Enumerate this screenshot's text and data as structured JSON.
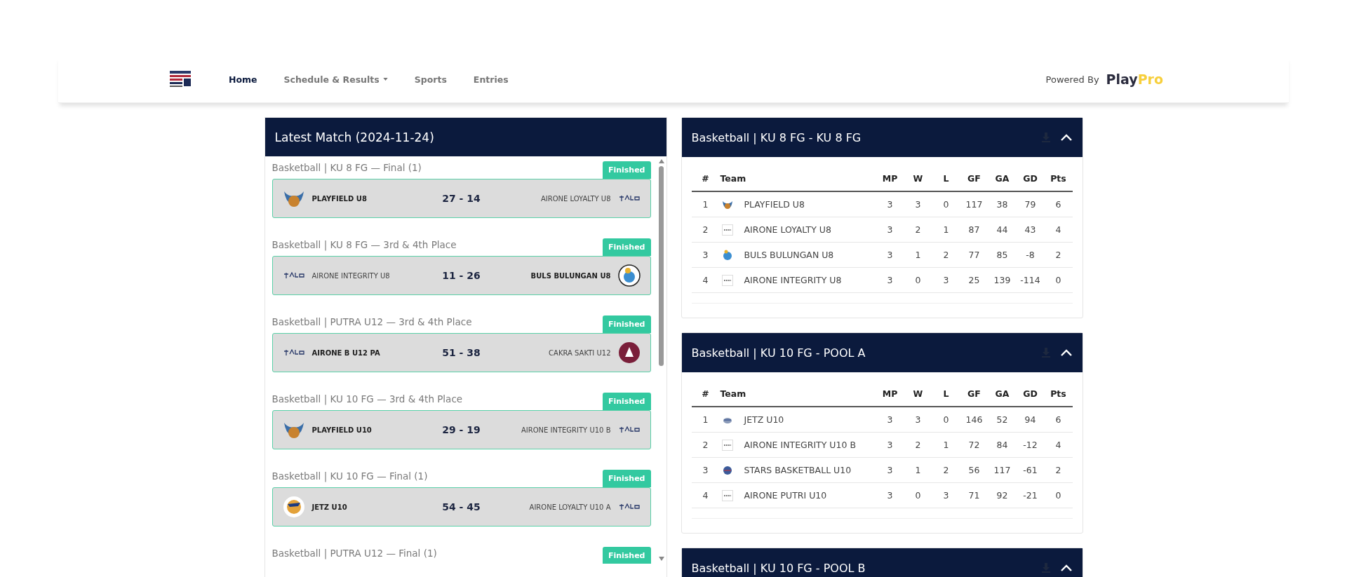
{
  "nav": {
    "items": [
      {
        "label": "Home",
        "selected": true,
        "dropdown": false
      },
      {
        "label": "Schedule & Results",
        "selected": false,
        "dropdown": true
      },
      {
        "label": "Sports",
        "selected": false,
        "dropdown": false
      },
      {
        "label": "Entries",
        "selected": false,
        "dropdown": false
      }
    ],
    "powered_by": "Powered By",
    "brand": {
      "first": "Play",
      "second": "Pro"
    }
  },
  "latest": {
    "title": "Latest Match (2024-11-24)",
    "matches": [
      {
        "round": "Basketball | KU 8 FG — Final (1)",
        "status": "Finished",
        "score": "27 - 14",
        "home": {
          "name": "PLAYFIELD U8",
          "kind": "wings",
          "winner": true
        },
        "away": {
          "name": "AIRONE LOYALTY U8",
          "kind": "airone",
          "winner": false
        }
      },
      {
        "round": "Basketball | KU 8 FG — 3rd & 4th Place",
        "status": "Finished",
        "score": "11 - 26",
        "home": {
          "name": "AIRONE INTEGRITY U8",
          "kind": "airone",
          "winner": false
        },
        "away": {
          "name": "BULS BULUNGAN U8",
          "kind": "bull",
          "winner": true
        }
      },
      {
        "round": "Basketball | PUTRA U12 — 3rd & 4th Place",
        "status": "Finished",
        "score": "51 - 38",
        "home": {
          "name": "AIRONE B U12 PA",
          "kind": "airone",
          "winner": true
        },
        "away": {
          "name": "CAKRA SAKTI U12",
          "kind": "maroon",
          "winner": false
        }
      },
      {
        "round": "Basketball | KU 10 FG — 3rd & 4th Place",
        "status": "Finished",
        "score": "29 - 19",
        "home": {
          "name": "PLAYFIELD U10",
          "kind": "wings",
          "winner": true
        },
        "away": {
          "name": "AIRONE INTEGRITY U10 B",
          "kind": "airone",
          "winner": false
        }
      },
      {
        "round": "Basketball | KU 10 FG — Final (1)",
        "status": "Finished",
        "score": "54 - 45",
        "home": {
          "name": "JETZ U10",
          "kind": "jet",
          "winner": true
        },
        "away": {
          "name": "AIRONE LOYALTY U10 A",
          "kind": "airone",
          "winner": false
        }
      },
      {
        "round": "Basketball | PUTRA U12 — Final (1)",
        "status": "Finished"
      }
    ]
  },
  "standings": [
    {
      "title": "Basketball | KU 8 FG - KU 8 FG",
      "expanded": true,
      "columns": [
        "#",
        "Team",
        "MP",
        "W",
        "L",
        "GF",
        "GA",
        "GD",
        "Pts"
      ],
      "rows": [
        {
          "kind": "wings",
          "cells": [
            "1",
            "PLAYFIELD U8",
            "3",
            "3",
            "0",
            "117",
            "38",
            "79",
            "6"
          ]
        },
        {
          "kind": "airone",
          "cells": [
            "2",
            "AIRONE LOYALTY U8",
            "3",
            "2",
            "1",
            "87",
            "44",
            "43",
            "4"
          ]
        },
        {
          "kind": "bull",
          "cells": [
            "3",
            "BULS BULUNGAN U8",
            "3",
            "1",
            "2",
            "77",
            "85",
            "-8",
            "2"
          ]
        },
        {
          "kind": "airone",
          "cells": [
            "4",
            "AIRONE INTEGRITY U8",
            "3",
            "0",
            "3",
            "25",
            "139",
            "-114",
            "0"
          ]
        }
      ]
    },
    {
      "title": "Basketball | KU 10 FG - POOL A",
      "expanded": true,
      "columns": [
        "#",
        "Team",
        "MP",
        "W",
        "L",
        "GF",
        "GA",
        "GD",
        "Pts"
      ],
      "rows": [
        {
          "kind": "jet",
          "cells": [
            "1",
            "JETZ U10",
            "3",
            "3",
            "0",
            "146",
            "52",
            "94",
            "6"
          ]
        },
        {
          "kind": "airone",
          "cells": [
            "2",
            "AIRONE INTEGRITY U10 B",
            "3",
            "2",
            "1",
            "72",
            "84",
            "-12",
            "4"
          ]
        },
        {
          "kind": "star",
          "cells": [
            "3",
            "STARS BASKETBALL U10",
            "3",
            "1",
            "2",
            "56",
            "117",
            "-61",
            "2"
          ]
        },
        {
          "kind": "airone",
          "cells": [
            "4",
            "AIRONE PUTRI U10",
            "3",
            "0",
            "3",
            "71",
            "92",
            "-21",
            "0"
          ]
        }
      ]
    },
    {
      "title": "Basketball | KU 10 FG - POOL B",
      "expanded": true
    }
  ]
}
